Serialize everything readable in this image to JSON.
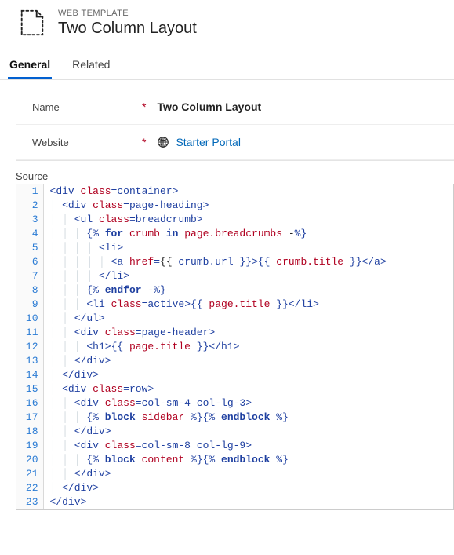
{
  "header": {
    "eyebrow": "WEB TEMPLATE",
    "title": "Two Column Layout"
  },
  "tabs": [
    {
      "label": "General",
      "active": true
    },
    {
      "label": "Related",
      "active": false
    }
  ],
  "form": {
    "name_label": "Name",
    "name_value": "Two Column Layout",
    "website_label": "Website",
    "website_value": "Starter Portal",
    "required_glyph": "*"
  },
  "source": {
    "label": "Source",
    "lines": [
      "<div class=container>",
      "  <div class=page-heading>",
      "    <ul class=breadcrumb>",
      "      {% for crumb in page.breadcrumbs -%}",
      "        <li>",
      "          <a href={{ crumb.url }}>{{ crumb.title }}</a>",
      "        </li>",
      "      {% endfor -%}",
      "      <li class=active>{{ page.title }}</li>",
      "    </ul>",
      "    <div class=page-header>",
      "      <h1>{{ page.title }}</h1>",
      "    </div>",
      "  </div>",
      "  <div class=row>",
      "    <div class=col-sm-4 col-lg-3>",
      "      {% block sidebar %}{% endblock %}",
      "    </div>",
      "    <div class=col-sm-8 col-lg-9>",
      "      {% block content %}{% endblock %}",
      "    </div>",
      "  </div>",
      "</div>"
    ]
  }
}
